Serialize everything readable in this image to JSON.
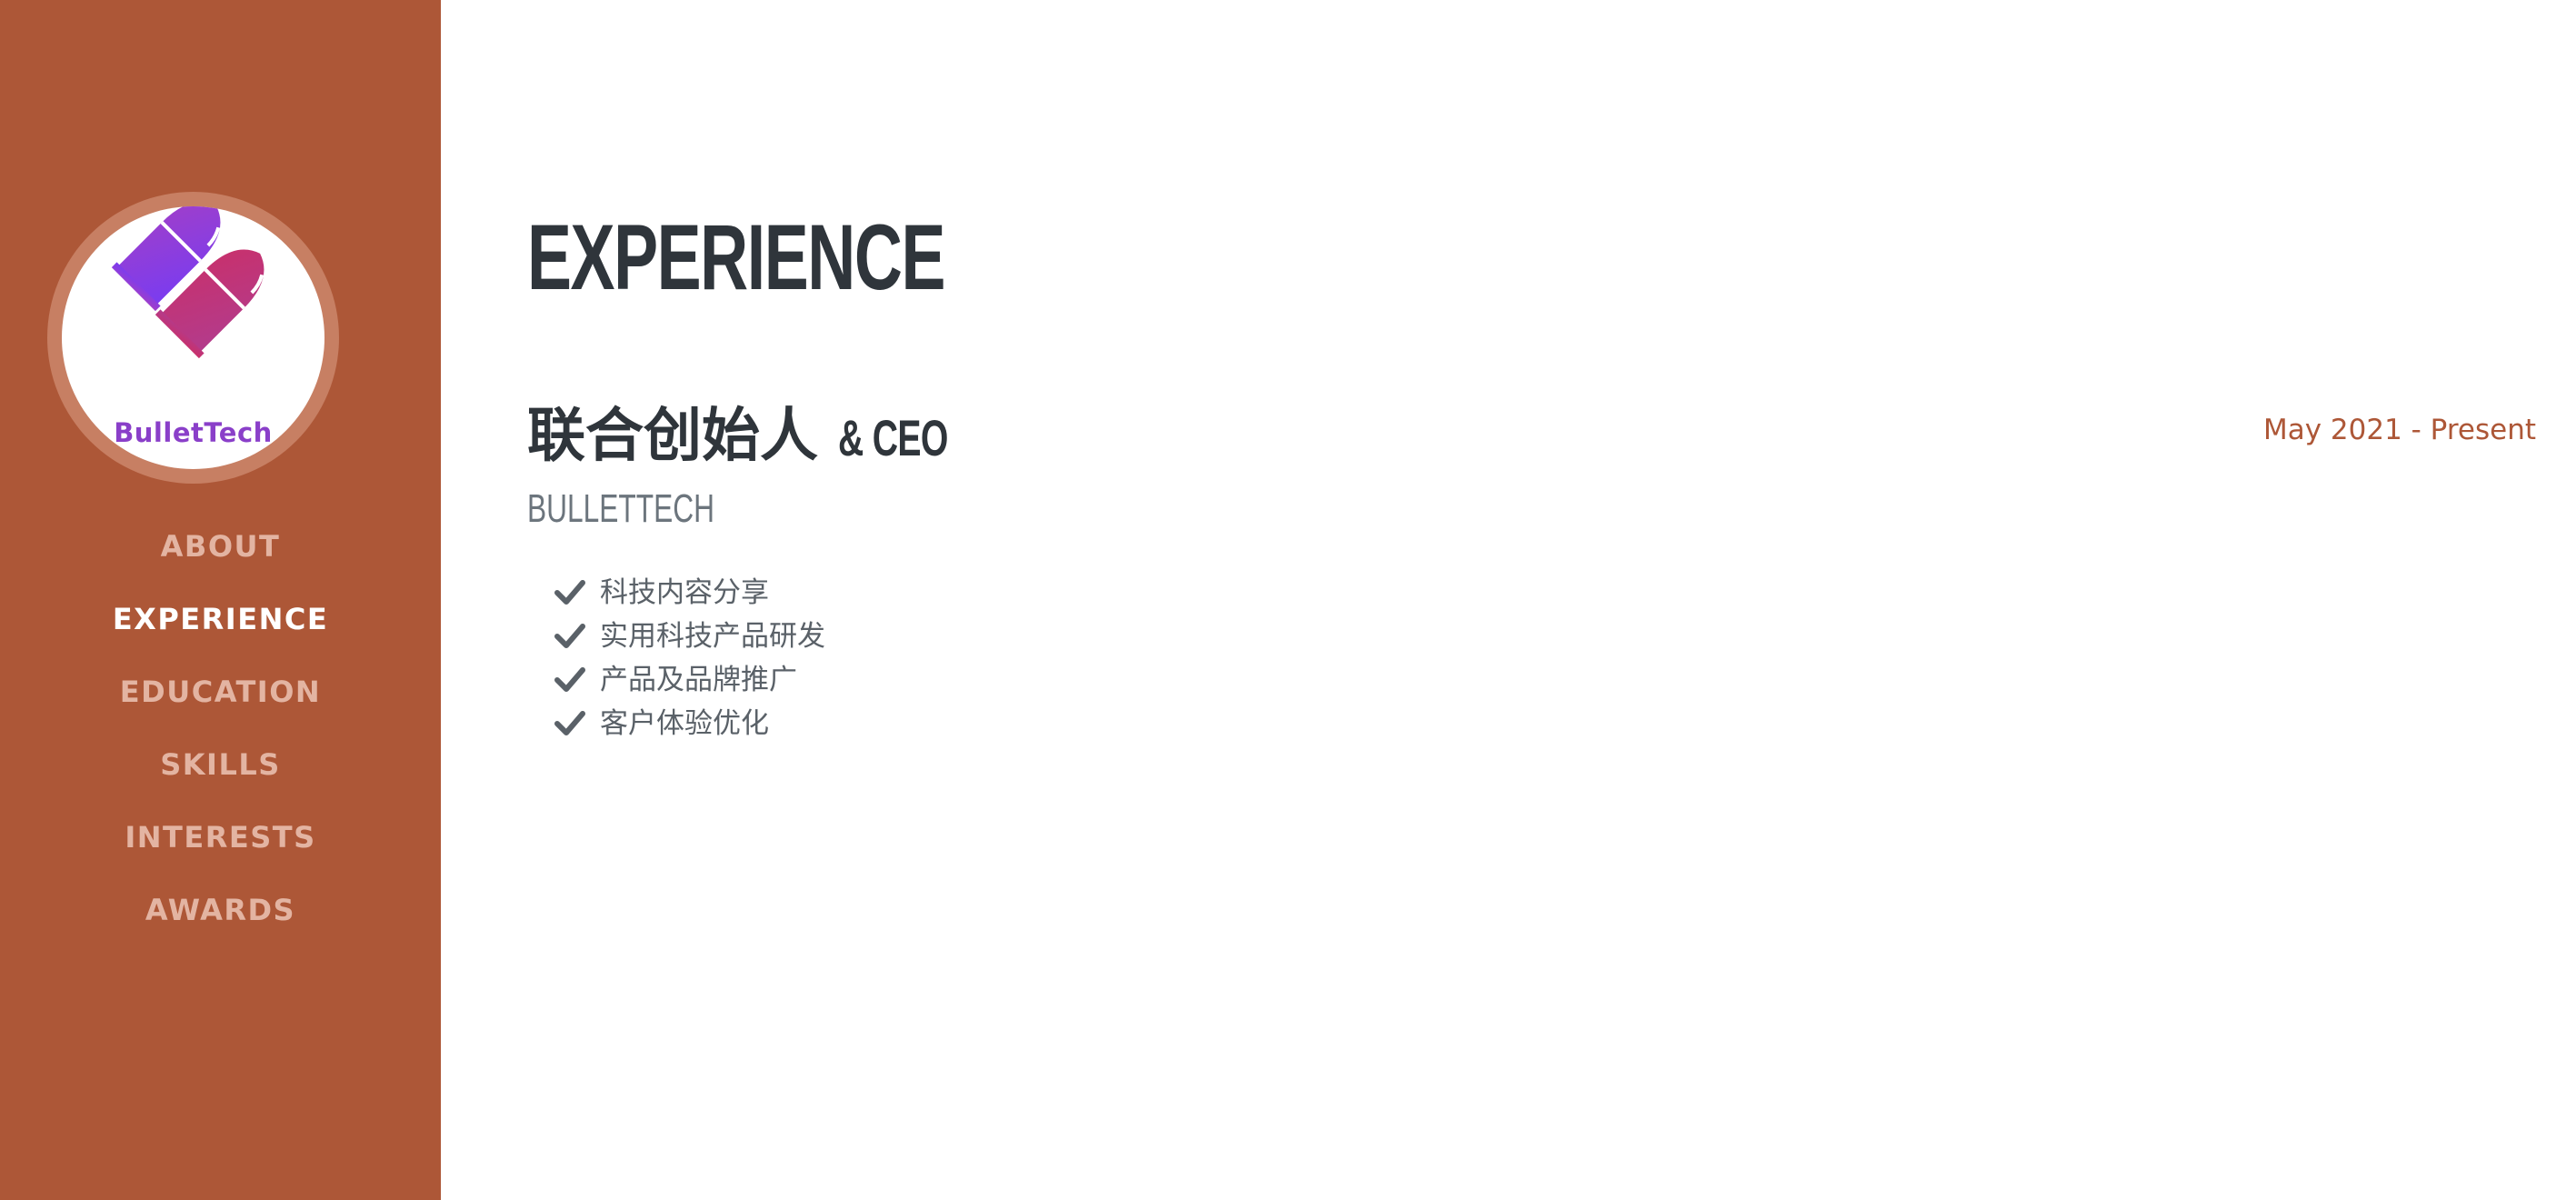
{
  "sidebar": {
    "logo_text": "BulletTech",
    "nav": [
      {
        "label": "ABOUT",
        "active": false
      },
      {
        "label": "EXPERIENCE",
        "active": true
      },
      {
        "label": "EDUCATION",
        "active": false
      },
      {
        "label": "SKILLS",
        "active": false
      },
      {
        "label": "INTERESTS",
        "active": false
      },
      {
        "label": "AWARDS",
        "active": false
      }
    ]
  },
  "main": {
    "section_title": "EXPERIENCE",
    "job": {
      "title_cn": "联合创始人",
      "title_en": "& CEO",
      "company": "BULLETTECH",
      "date": "May 2021 - Present",
      "bullets": [
        "科技内容分享",
        "实用科技产品研发",
        "产品及品牌推广",
        "客户体验优化"
      ]
    }
  },
  "colors": {
    "sidebar_bg": "#ad5737",
    "nav_active": "#ffffff",
    "nav_inactive": "#e3b4a2",
    "heading": "#2f353b",
    "accent": "#ad5737",
    "logo_purple": "#8a3fc9"
  },
  "icons": {
    "logo": "bullets-logo-icon",
    "bullet_marker": "check-icon"
  }
}
